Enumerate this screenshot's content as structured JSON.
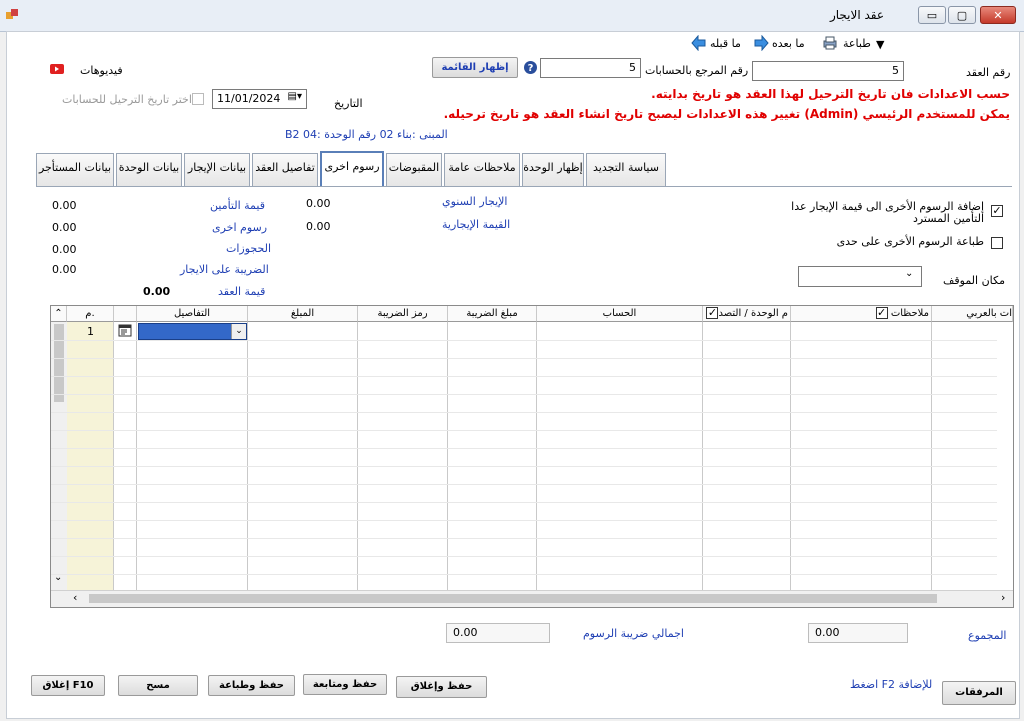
{
  "window": {
    "title": "عقد الايجار",
    "minimize": "▭",
    "maximize": "▢",
    "close": "✕"
  },
  "toolbar": {
    "print": "طباعة",
    "next": "ما بعده",
    "prev": "ما قبله"
  },
  "header": {
    "contract_no_label": "رقم العقد",
    "contract_no_value": "5",
    "ref_no_label": "رقم المرجع بالحسابات",
    "ref_no_value": "5",
    "show_list": "إظهار القائمة",
    "videos_label": "فيديوهات",
    "date_label": "التاريخ",
    "date_value": "11/01/2024",
    "posting_date_label": "اختر تاريخ الترحيل للحسابات",
    "warn_line1": "حسب الاعدادات فان تاريخ الترحيل لهذا العقد هو تاريخ بدايته.",
    "warn_line2": "يمكن للمستخدم الرئيسي (Admin) تغيير هذه الاعدادات ليصبح تاريخ انشاء العقد هو تاريخ ترحيله.",
    "unit_info": "المبنى :بناء 02 رقم الوحدة :B2 04"
  },
  "tabs": [
    "بيانات المستأجر",
    "بيانات الوحدة",
    "بيانات الإيجار",
    "تفاصيل العقد",
    "رسوم اخرى",
    "المقبوضات",
    "ملاحظات عامة",
    "إظهار الوحدة",
    "سياسة التجديد"
  ],
  "summary": {
    "annual_rent_label": "الإيجار السنوي",
    "annual_rent_value": "0.00",
    "rent_value_label": "القيمة الإيجارية",
    "rent_value_value": "0.00",
    "insurance_label": "قيمة التأمين",
    "insurance_value": "0.00",
    "other_fees_label": "رسوم اخرى",
    "other_fees_value": "0.00",
    "reservations_label": "الحجوزات",
    "reservations_value": "0.00",
    "rent_tax_label": "الضريبة على الايجار",
    "rent_tax_value": "0.00",
    "contract_value_label": "قيمة العقد",
    "contract_value_value": "0.00"
  },
  "options": {
    "add_fees_line1": "إضافة الرسوم الأخرى الى قيمة الإيجار عدا",
    "add_fees_line2": "التأمين المسترد",
    "print_fees": "طباعة الرسوم الأخرى على حدى",
    "parking_label": "مكان الموقف"
  },
  "grid": {
    "columns": [
      "م.",
      "التفاصيل",
      "المبلغ",
      "رمز الضريبة",
      "مبلغ الضريبة",
      "الحساب",
      "م الوحدة / التصد",
      "ملاحظات",
      "ات بالعربي"
    ],
    "row1_no": "1"
  },
  "footer": {
    "total_label": "المجموع",
    "total_value": "0.00",
    "tax_total_label": "اجمالي ضريبة الرسوم",
    "tax_total_value": "0.00",
    "f2_hint": "اضغط F2 للإضافة",
    "attachments": "المرفقات",
    "save_close": "حفظ وإغلاق",
    "save_continue": "حفظ ومتابعة",
    "save_print": "حفظ وطباعة",
    "clear": "مسح",
    "close_f10": "إغلاق F10"
  }
}
